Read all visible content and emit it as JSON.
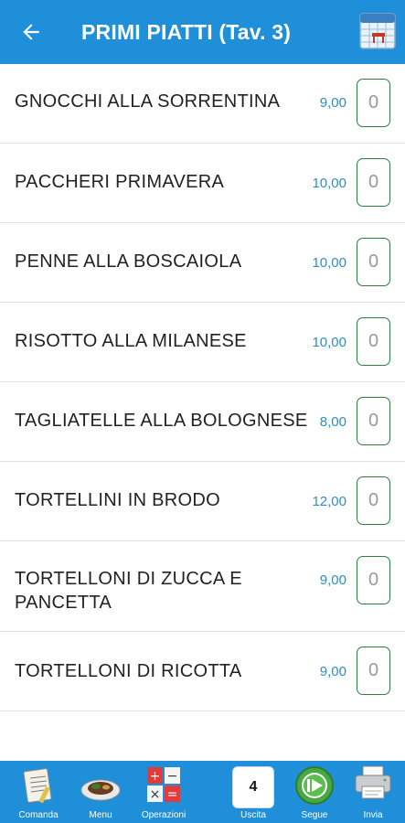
{
  "header": {
    "title": "PRIMI PIATTI (Tav. 3)",
    "back_icon": "arrow-left-icon",
    "table_icon": "table-icon"
  },
  "items": [
    {
      "name": "GNOCCHI ALLA SORRENTINA",
      "price": "9,00",
      "qty": "0"
    },
    {
      "name": "PACCHERI PRIMAVERA",
      "price": "10,00",
      "qty": "0"
    },
    {
      "name": "PENNE ALLA BOSCAIOLA",
      "price": "10,00",
      "qty": "0"
    },
    {
      "name": "RISOTTO ALLA MILANESE",
      "price": "10,00",
      "qty": "0"
    },
    {
      "name": "TAGLIATELLE ALLA BOLOGNESE",
      "price": "8,00",
      "qty": "0"
    },
    {
      "name": "TORTELLINI IN BRODO",
      "price": "12,00",
      "qty": "0"
    },
    {
      "name": "TORTELLONI DI ZUCCA E PANCETTA",
      "price": "9,00",
      "qty": "0"
    },
    {
      "name": "TORTELLONI DI RICOTTA",
      "price": "9,00",
      "qty": "0"
    }
  ],
  "bottom": {
    "comanda": "Comanda",
    "menu": "Menu",
    "operazioni": "Operazioni",
    "uscita_value": "4",
    "uscita": "Uscita",
    "segue": "Segue",
    "invia": "Invia"
  },
  "colors": {
    "header_bg": "#1e8fd8",
    "price": "#2a8fc6",
    "qty_border": "#2f7d43"
  }
}
